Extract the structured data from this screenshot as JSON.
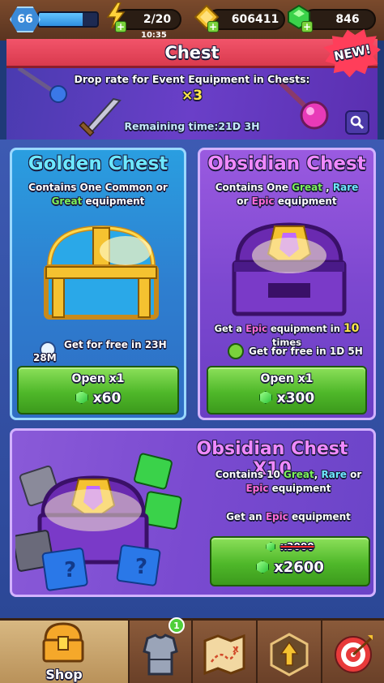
{
  "topbar": {
    "level": "66",
    "xp_fraction": 0.75,
    "energy": "2/20",
    "energy_timer": "10:35",
    "gold": "606411",
    "gems": "846"
  },
  "header": {
    "title": "Chest",
    "new_badge": "NEW!"
  },
  "event_banner": {
    "text": "Drop rate for Event Equipment in Chests:",
    "multiplier": "×3",
    "remaining": "Remaining time:21D 3H"
  },
  "golden_chest": {
    "title": "Golden Chest",
    "desc_prefix": "Contains One ",
    "desc_word1": "Common",
    "desc_mid": " or",
    "desc_word2": "Great",
    "desc_suffix": " equipment",
    "free_text_line1": "Get for free in 23H",
    "free_text_line2": "28M",
    "button_label": "Open x1",
    "button_price": "x60"
  },
  "obsidian_chest": {
    "title": "Obsidian Chest",
    "desc_prefix": "Contains One ",
    "desc_word1": "Great",
    "desc_sep": " , ",
    "desc_word2": "Rare",
    "desc_line2_prefix": "or ",
    "desc_word3": "Epic",
    "desc_suffix": " equipment",
    "pity_prefix": "Get a ",
    "pity_word": "Epic",
    "pity_mid": " equipment in ",
    "pity_count": "10",
    "pity_suffix": " times",
    "free_text": "Get for free in 1D 5H",
    "button_label": "Open x1",
    "button_price": "x300"
  },
  "obsidian_x10": {
    "title": "Obsidian Chest X10",
    "desc_prefix": "Contains 10 ",
    "desc_word1": "Great",
    "desc_sep": ", ",
    "desc_word2": "Rare",
    "desc_mid": " or",
    "desc_word3": "Epic",
    "desc_suffix": " equipment",
    "guarantee_prefix": "Get an ",
    "guarantee_word": "Epic",
    "guarantee_suffix": " equipment",
    "old_price": "x3000",
    "button_price": "x2600"
  },
  "nav": {
    "shop_label": "Shop",
    "equipment_badge": "1"
  },
  "colors": {
    "accent_green": "#4fb82a",
    "title_red": "#e64559",
    "golden_card": "#2e7fd0",
    "obsidian_card": "#7d48d0"
  }
}
